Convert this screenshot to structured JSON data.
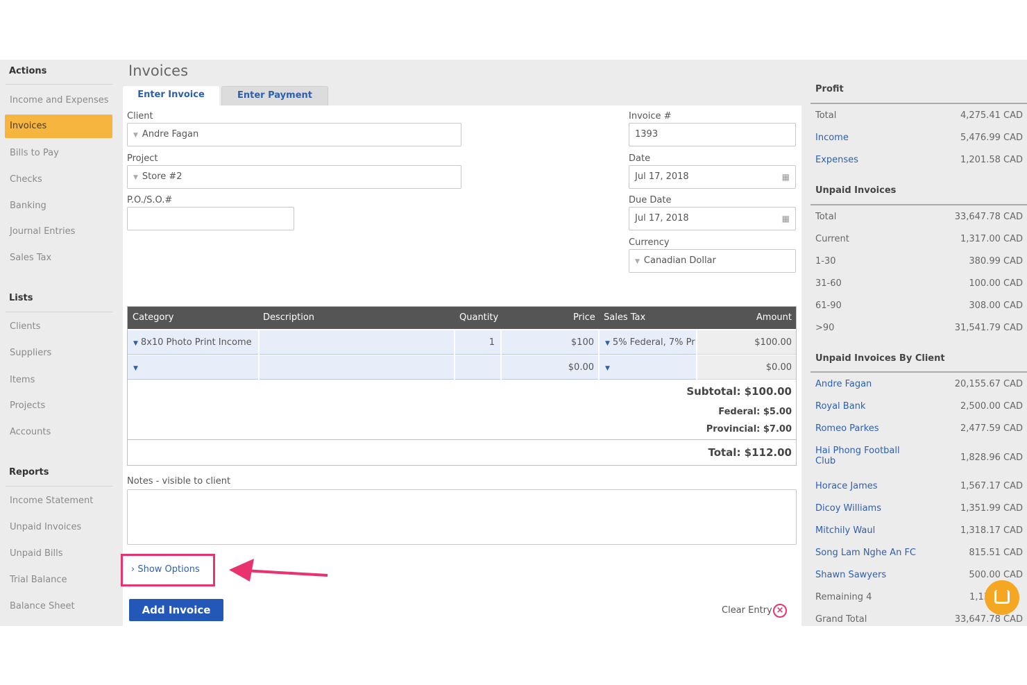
{
  "sidebar": {
    "actions_heading": "Actions",
    "actions": [
      "Income and Expenses",
      "Invoices",
      "Bills to Pay",
      "Checks",
      "Banking",
      "Journal Entries",
      "Sales Tax"
    ],
    "lists_heading": "Lists",
    "lists": [
      "Clients",
      "Suppliers",
      "Items",
      "Projects",
      "Accounts"
    ],
    "reports_heading": "Reports",
    "reports": [
      "Income Statement",
      "Unpaid Invoices",
      "Unpaid Bills",
      "Trial Balance",
      "Balance Sheet"
    ]
  },
  "main": {
    "title": "Invoices",
    "tabs": [
      "Enter Invoice",
      "Enter Payment"
    ],
    "form": {
      "client_label": "Client",
      "client_value": "Andre Fagan",
      "project_label": "Project",
      "project_value": "Store #2",
      "po_label": "P.O./S.O.#",
      "po_value": "",
      "invoice_no_label": "Invoice #",
      "invoice_no_value": "1393",
      "date_label": "Date",
      "date_value": "Jul 17, 2018",
      "due_label": "Due Date",
      "due_value": "Jul 17, 2018",
      "currency_label": "Currency",
      "currency_value": "Canadian Dollar"
    },
    "table": {
      "headers": [
        "Category",
        "Description",
        "Quantity",
        "Price",
        "Sales Tax",
        "Amount"
      ],
      "rows": [
        {
          "category": "8x10 Photo Print Income",
          "description": "",
          "quantity": "1",
          "price": "$100",
          "tax": "5% Federal, 7% Pr",
          "amount": "$100.00"
        },
        {
          "category": "",
          "description": "",
          "quantity": "",
          "price": "$0.00",
          "tax": "",
          "amount": "$0.00"
        }
      ],
      "subtotal": "Subtotal: $100.00",
      "federal": "Federal: $5.00",
      "provincial": "Provincial: $7.00",
      "total": "Total: $112.00"
    },
    "notes_label": "Notes - visible to client",
    "show_options": "Show Options",
    "add_invoice": "Add Invoice",
    "clear_entry": "Clear Entry"
  },
  "summary": {
    "profit_heading": "Profit",
    "profit": [
      {
        "label": "Total",
        "value": "4,275.41 CAD"
      },
      {
        "label": "Income",
        "value": "5,476.99 CAD"
      },
      {
        "label": "Expenses",
        "value": "1,201.58 CAD"
      }
    ],
    "unpaid_heading": "Unpaid Invoices",
    "unpaid": [
      {
        "label": "Total",
        "value": "33,647.78 CAD"
      },
      {
        "label": "Current",
        "value": "1,317.00 CAD"
      },
      {
        "label": "1-30",
        "value": "380.99 CAD"
      },
      {
        "label": "31-60",
        "value": "100.00 CAD"
      },
      {
        "label": "61-90",
        "value": "308.00 CAD"
      },
      {
        "label": ">90",
        "value": "31,541.79 CAD"
      }
    ],
    "by_client_heading": "Unpaid Invoices By Client",
    "by_client": [
      {
        "label": "Andre Fagan",
        "value": "20,155.67 CAD"
      },
      {
        "label": "Royal Bank",
        "value": "2,500.00 CAD"
      },
      {
        "label": "Romeo Parkes",
        "value": "2,477.59 CAD"
      },
      {
        "label": "Hai Phong Football",
        "label2": "Club",
        "value": "1,828.96 CAD"
      },
      {
        "label": "Horace James",
        "value": "1,567.17 CAD"
      },
      {
        "label": "Dicoy Williams",
        "value": "1,351.99 CAD"
      },
      {
        "label": "Mitchily Waul",
        "value": "1,318.17 CAD"
      },
      {
        "label": "Song Lam Nghe An FC",
        "value": "815.51 CAD"
      },
      {
        "label": "Shawn Sawyers",
        "value": "500.00 CAD"
      },
      {
        "label": "Remaining 4",
        "value": "1,13"
      },
      {
        "label": "Grand Total",
        "value": "33,647.78 CAD"
      }
    ]
  },
  "colors": {
    "accent": "#f5b53e",
    "link": "#2d5fb0",
    "button": "#2458b8",
    "highlight": "#e8336e",
    "table_header": "#555555"
  }
}
